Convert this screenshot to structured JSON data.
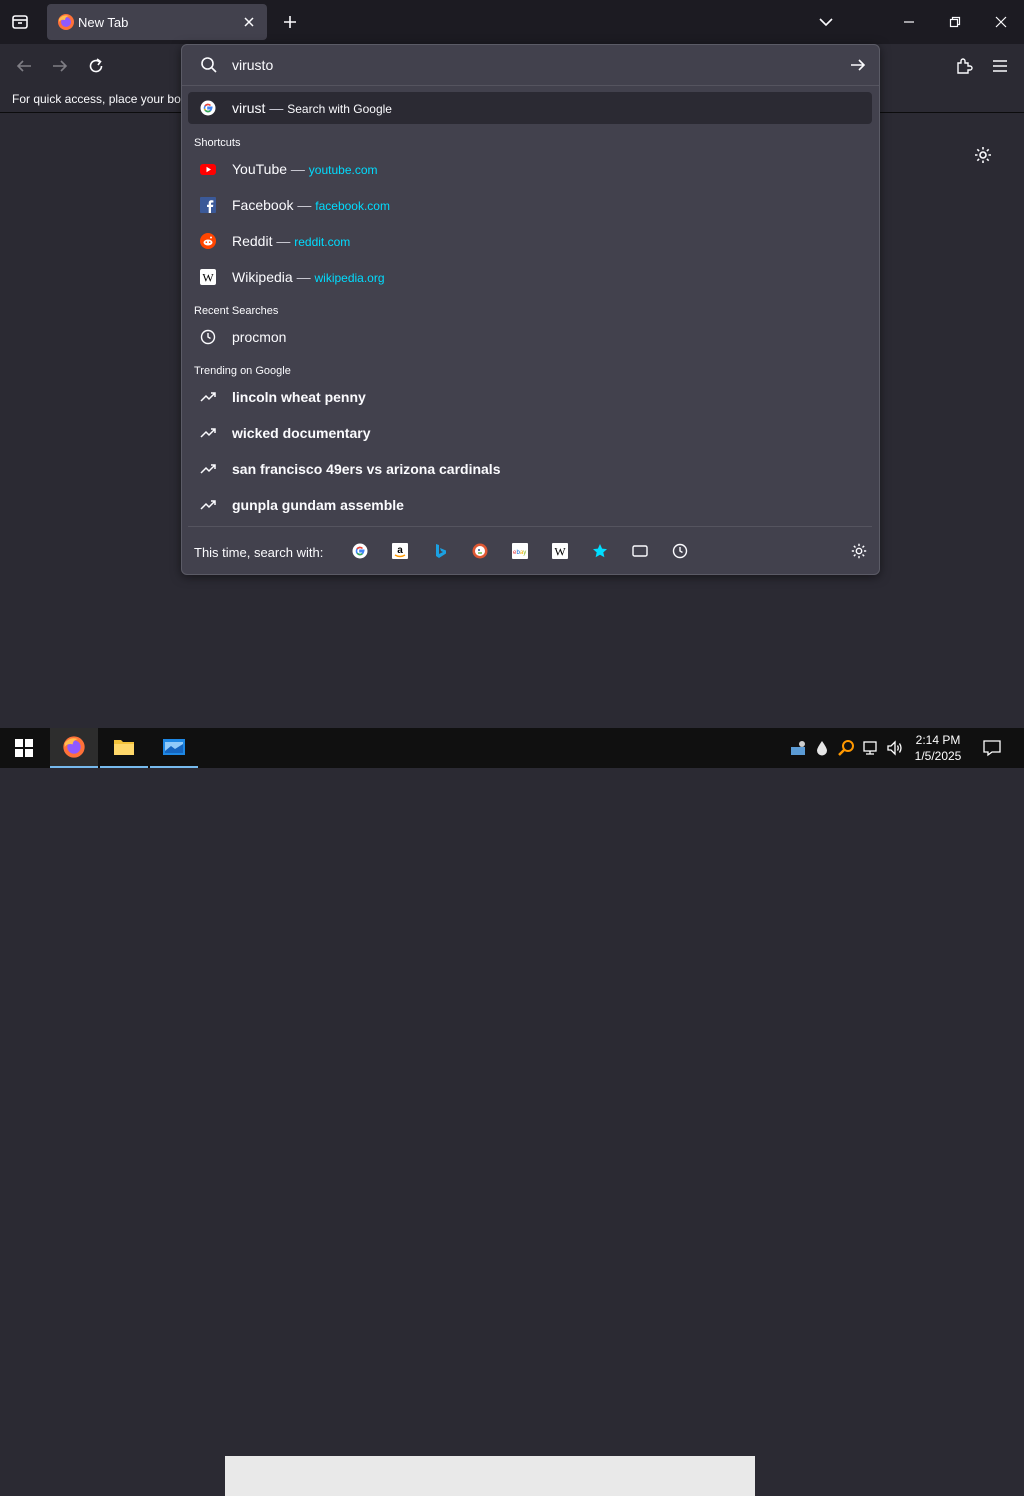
{
  "tab": {
    "title": "New Tab"
  },
  "bookmarks_bar": {
    "message": "For quick access, place your boo"
  },
  "urlbar": {
    "input_value": "virusto",
    "heuristic": {
      "text": "virust",
      "sep": " — ",
      "action": "Search with Google"
    }
  },
  "groups": {
    "shortcuts": "Shortcuts",
    "recent": "Recent Searches",
    "trending": "Trending on Google"
  },
  "shortcuts": [
    {
      "name": "YouTube",
      "sep": " — ",
      "url": "youtube.com",
      "icon": "youtube-icon"
    },
    {
      "name": "Facebook",
      "sep": " — ",
      "url": "facebook.com",
      "icon": "facebook-icon"
    },
    {
      "name": "Reddit",
      "sep": " — ",
      "url": "reddit.com",
      "icon": "reddit-icon"
    },
    {
      "name": "Wikipedia",
      "sep": " — ",
      "url": "wikipedia.org",
      "icon": "wikipedia-icon"
    }
  ],
  "recent": [
    {
      "text": "procmon",
      "icon": "history-icon"
    }
  ],
  "trending": [
    {
      "text": "lincoln wheat penny"
    },
    {
      "text": "wicked documentary"
    },
    {
      "text": "san francisco 49ers vs arizona cardinals"
    },
    {
      "text": "gunpla gundam assemble"
    }
  ],
  "oneoff": {
    "label": "This time, search with:",
    "engines": [
      "google-icon",
      "amazon-icon",
      "bing-icon",
      "duckduckgo-icon",
      "ebay-icon",
      "wikipedia-icon",
      "bookmarks-star-icon",
      "tabs-icon",
      "history-icon"
    ]
  },
  "taskbar": {
    "time": "2:14 PM",
    "date": "1/5/2025"
  },
  "colors": {
    "accent_url": "#00ddff",
    "panel_bg": "#42414d",
    "chrome_bg": "#1c1b22"
  }
}
